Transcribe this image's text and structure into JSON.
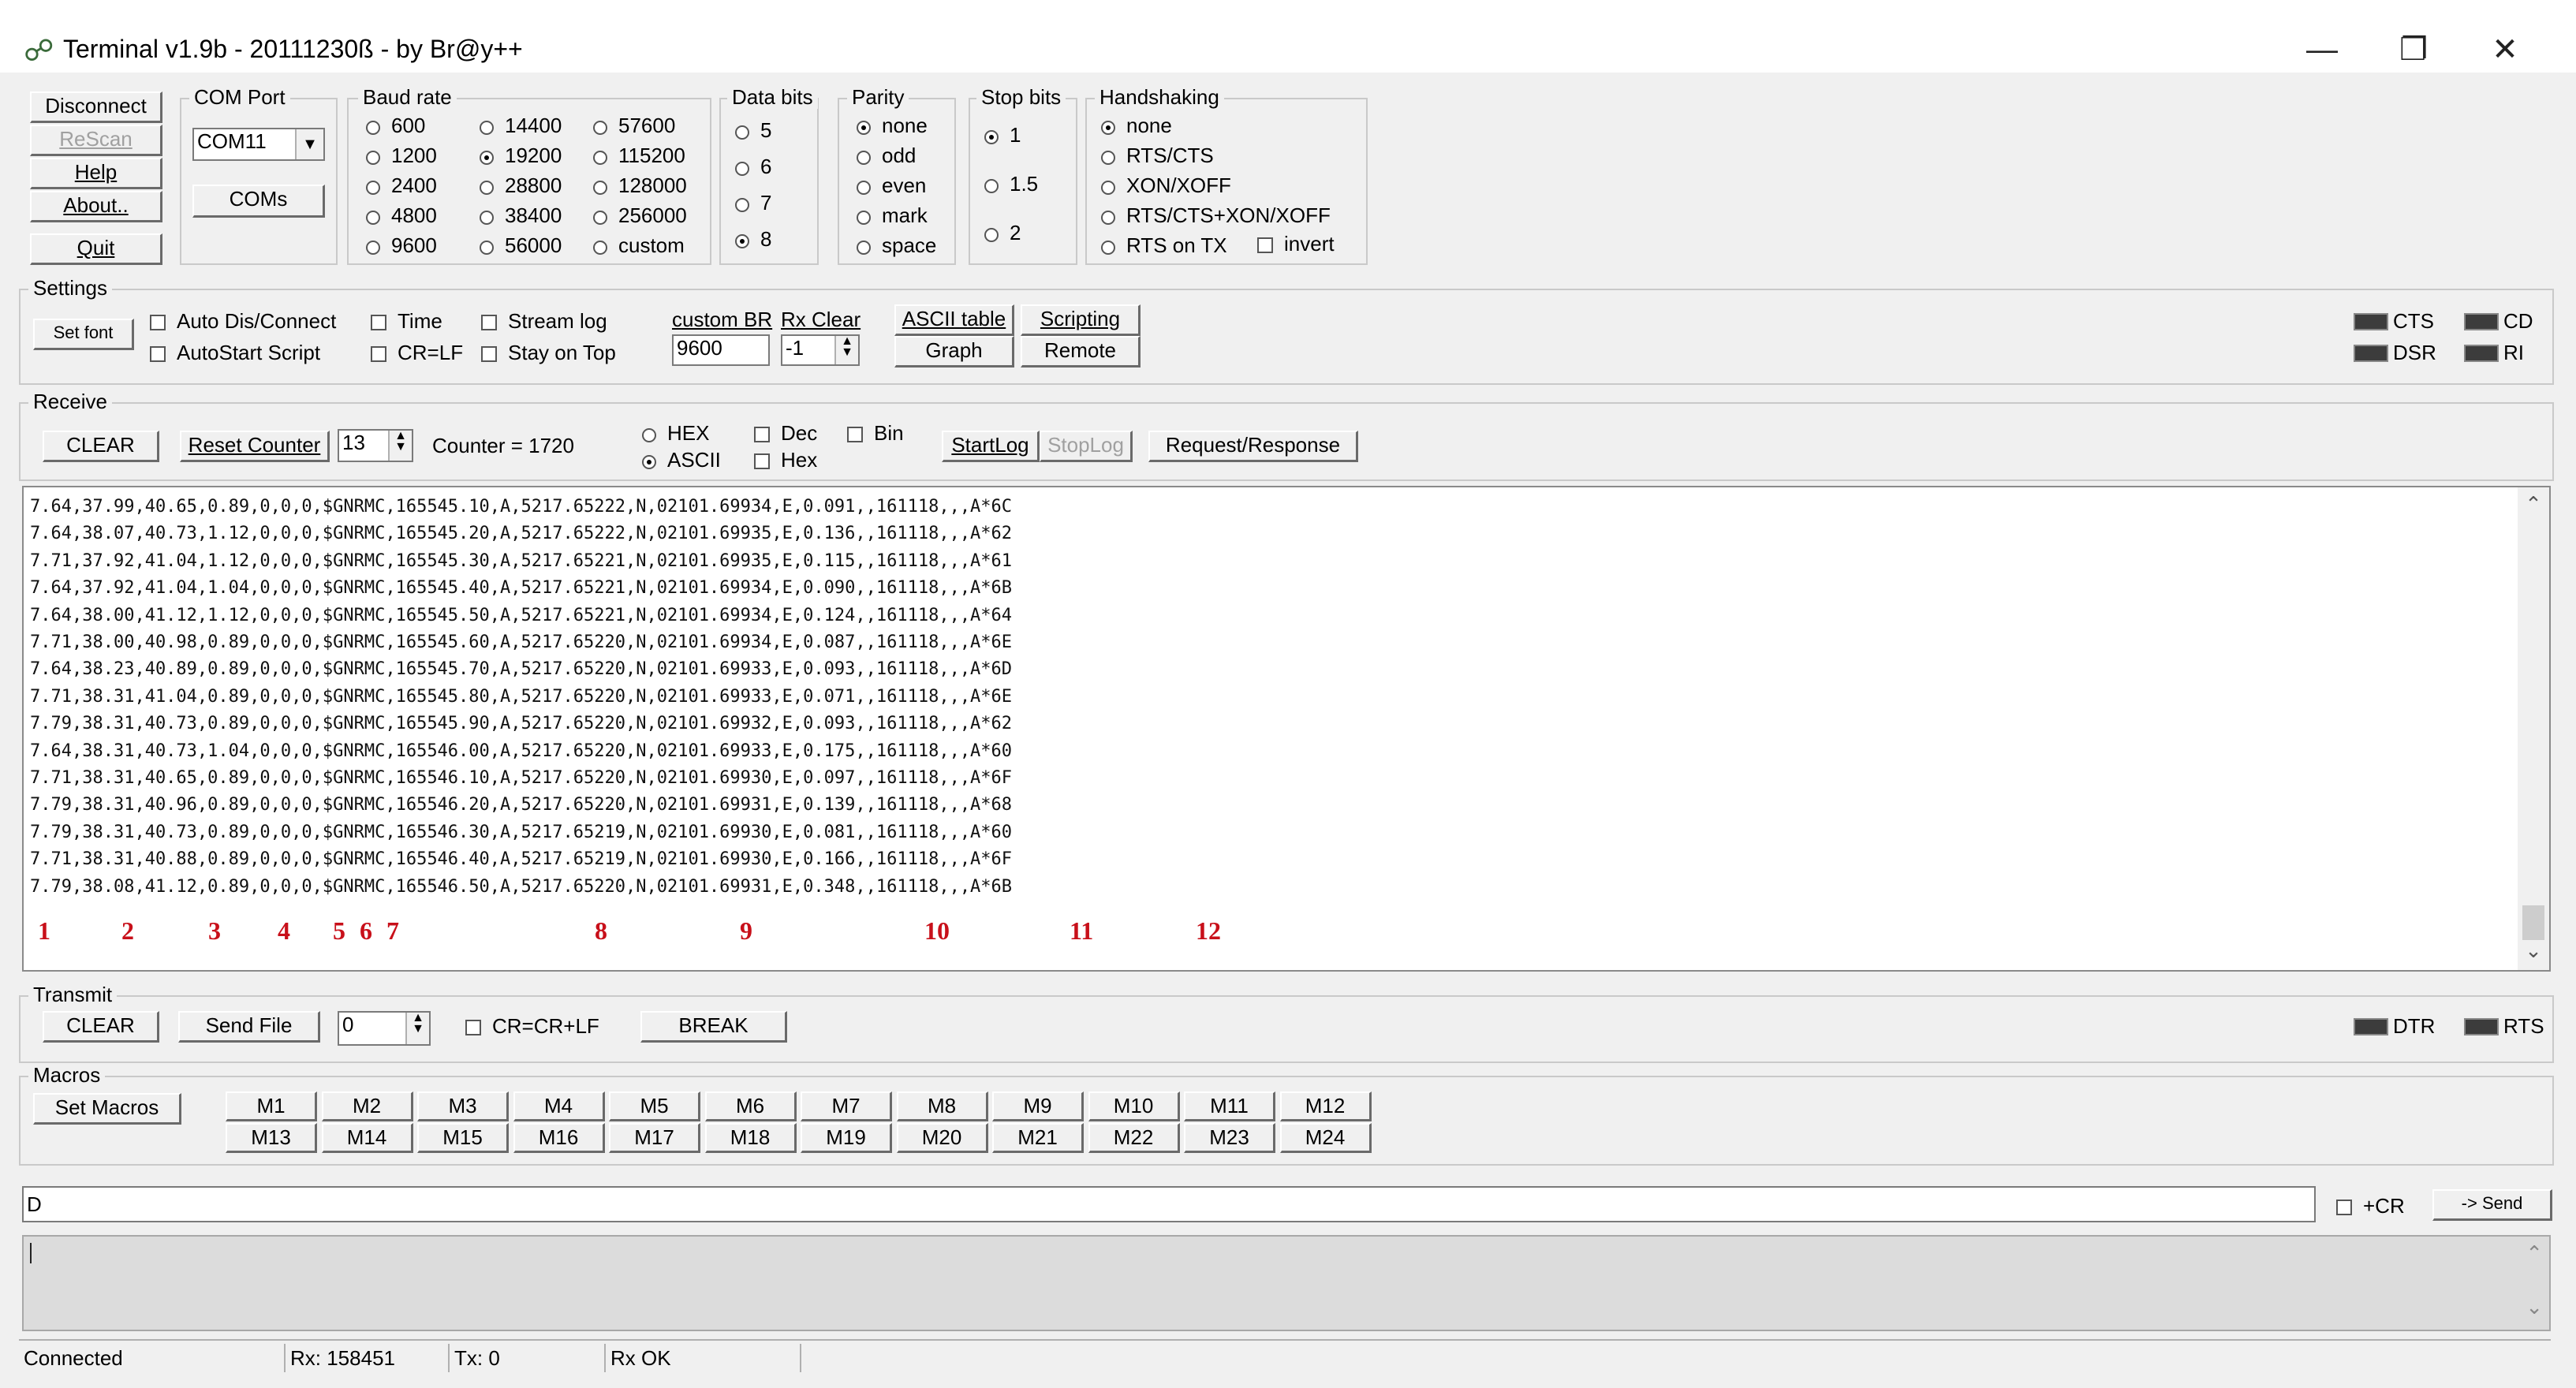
{
  "window": {
    "title": "Terminal v1.9b - 20111230ß - by Br@y++",
    "controls": {
      "minimize": "—",
      "restore": "❐",
      "close": "✕"
    }
  },
  "left_buttons": {
    "disconnect": "Disconnect",
    "rescan": "ReScan",
    "help": "Help",
    "about": "About..",
    "quit": "Quit"
  },
  "com_port": {
    "legend": "COM Port",
    "value": "COM11",
    "coms_button": "COMs"
  },
  "baud_rate": {
    "legend": "Baud rate",
    "options": [
      "600",
      "1200",
      "2400",
      "4800",
      "9600",
      "14400",
      "19200",
      "28800",
      "38400",
      "56000",
      "57600",
      "115200",
      "128000",
      "256000",
      "custom"
    ],
    "selected": "19200"
  },
  "data_bits": {
    "legend": "Data bits",
    "options": [
      "5",
      "6",
      "7",
      "8"
    ],
    "selected": "8"
  },
  "parity": {
    "legend": "Parity",
    "options": [
      "none",
      "odd",
      "even",
      "mark",
      "space"
    ],
    "selected": "none"
  },
  "stop_bits": {
    "legend": "Stop bits",
    "options": [
      "1",
      "1.5",
      "2"
    ],
    "selected": "1"
  },
  "handshaking": {
    "legend": "Handshaking",
    "options": [
      "none",
      "RTS/CTS",
      "XON/XOFF",
      "RTS/CTS+XON/XOFF",
      "RTS on TX"
    ],
    "selected": "none",
    "invert": "invert"
  },
  "settings": {
    "legend": "Settings",
    "set_font": "Set font",
    "auto_dis_connect": "Auto Dis/Connect",
    "autostart_script": "AutoStart Script",
    "time": "Time",
    "cr_lf": "CR=LF",
    "stream_log": "Stream log",
    "stay_on_top": "Stay on Top",
    "custom_br_label": "custom BR",
    "custom_br_value": "9600",
    "rx_clear_label": "Rx Clear",
    "rx_clear_value": "-1",
    "ascii_table": "ASCII table",
    "graph": "Graph",
    "scripting": "Scripting",
    "remote": "Remote"
  },
  "leds_top": {
    "cts": "CTS",
    "cd": "CD",
    "dsr": "DSR",
    "ri": "RI"
  },
  "receive": {
    "legend": "Receive",
    "clear": "CLEAR",
    "reset_counter": "Reset Counter",
    "counter_spin": "13",
    "counter_label": "Counter = 1720",
    "hex": "HEX",
    "ascii": "ASCII",
    "dec": "Dec",
    "hex_check": "Hex",
    "bin": "Bin",
    "start_log": "StartLog",
    "stop_log": "StopLog",
    "request_response": "Request/Response"
  },
  "rx_lines": [
    "7.64,37.99,40.65,0.89,0,0,0,$GNRMC,165545.10,A,5217.65222,N,02101.69934,E,0.091,,161118,,,A*6C",
    "7.64,38.07,40.73,1.12,0,0,0,$GNRMC,165545.20,A,5217.65222,N,02101.69935,E,0.136,,161118,,,A*62",
    "7.71,37.92,41.04,1.12,0,0,0,$GNRMC,165545.30,A,5217.65221,N,02101.69935,E,0.115,,161118,,,A*61",
    "7.64,37.92,41.04,1.04,0,0,0,$GNRMC,165545.40,A,5217.65221,N,02101.69934,E,0.090,,161118,,,A*6B",
    "7.64,38.00,41.12,1.12,0,0,0,$GNRMC,165545.50,A,5217.65221,N,02101.69934,E,0.124,,161118,,,A*64",
    "7.71,38.00,40.98,0.89,0,0,0,$GNRMC,165545.60,A,5217.65220,N,02101.69934,E,0.087,,161118,,,A*6E",
    "7.64,38.23,40.89,0.89,0,0,0,$GNRMC,165545.70,A,5217.65220,N,02101.69933,E,0.093,,161118,,,A*6D",
    "7.71,38.31,41.04,0.89,0,0,0,$GNRMC,165545.80,A,5217.65220,N,02101.69933,E,0.071,,161118,,,A*6E",
    "7.79,38.31,40.73,0.89,0,0,0,$GNRMC,165545.90,A,5217.65220,N,02101.69932,E,0.093,,161118,,,A*62",
    "7.64,38.31,40.73,1.04,0,0,0,$GNRMC,165546.00,A,5217.65220,N,02101.69933,E,0.175,,161118,,,A*60",
    "7.71,38.31,40.65,0.89,0,0,0,$GNRMC,165546.10,A,5217.65220,N,02101.69930,E,0.097,,161118,,,A*6F",
    "7.79,38.31,40.96,0.89,0,0,0,$GNRMC,165546.20,A,5217.65220,N,02101.69931,E,0.139,,161118,,,A*68",
    "7.79,38.31,40.73,0.89,0,0,0,$GNRMC,165546.30,A,5217.65219,N,02101.69930,E,0.081,,161118,,,A*60",
    "7.71,38.31,40.88,0.89,0,0,0,$GNRMC,165546.40,A,5217.65219,N,02101.69930,E,0.166,,161118,,,A*6F",
    "7.79,38.08,41.12,0.89,0,0,0,$GNRMC,165546.50,A,5217.65220,N,02101.69931,E,0.348,,161118,,,A*6B"
  ],
  "annotations": [
    "1",
    "2",
    "3",
    "4",
    "5",
    "6",
    "7",
    "8",
    "9",
    "10",
    "11",
    "12"
  ],
  "transmit": {
    "legend": "Transmit",
    "clear": "CLEAR",
    "send_file": "Send File",
    "spin": "0",
    "cr_crlf": "CR=CR+LF",
    "break": "BREAK",
    "dtr": "DTR",
    "rts": "RTS"
  },
  "macros": {
    "legend": "Macros",
    "set_macros": "Set Macros",
    "row1": [
      "M1",
      "M2",
      "M3",
      "M4",
      "M5",
      "M6",
      "M7",
      "M8",
      "M9",
      "M10",
      "M11",
      "M12"
    ],
    "row2": [
      "M13",
      "M14",
      "M15",
      "M16",
      "M17",
      "M18",
      "M19",
      "M20",
      "M21",
      "M22",
      "M23",
      "M24"
    ]
  },
  "send": {
    "input": "D",
    "plus_cr": "+CR",
    "send_button": "-> Send"
  },
  "status": {
    "state": "Connected",
    "rx": "Rx: 158451",
    "tx": "Tx: 0",
    "rx_ok": "Rx OK"
  }
}
